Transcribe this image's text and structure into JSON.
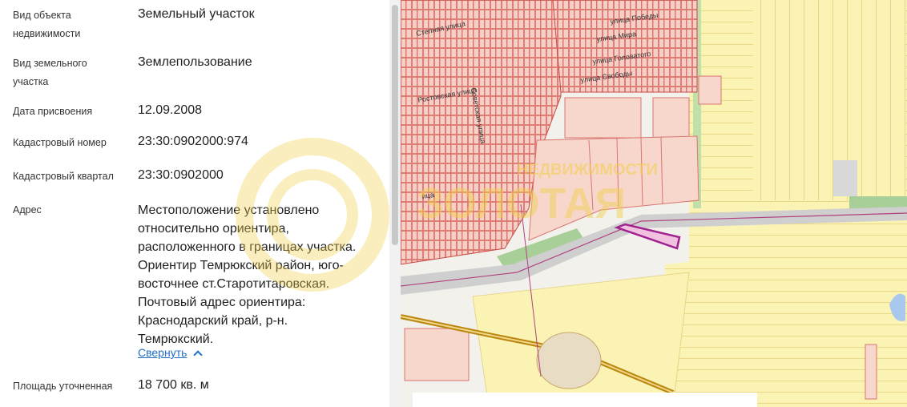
{
  "details": {
    "rows": [
      {
        "label": "Вид объекта\nнедвижимости",
        "value": "Земельный участок"
      },
      {
        "label": "Вид земельного\nучастка",
        "value": "Землепользование"
      },
      {
        "label": "Дата присвоения",
        "value": "12.09.2008"
      },
      {
        "label": "Кадастровый номер",
        "value": "23:30:0902000:974"
      },
      {
        "label": "Кадастровый квартал",
        "value": "23:30:0902000"
      },
      {
        "label": "Адрес",
        "value": "Местоположение установлено\nотносительно ориентира,\nрасположенного в границах участка.\nОриентир Темрюкский район, юго-\nвосточнее ст.Старотитаровская.\nПочтовый адрес ориентира:\nКраснодарский край, р-н.\nТемрюкский."
      },
      {
        "label": "Площадь уточненная",
        "value": "18 700 кв. м"
      }
    ],
    "collapse_label": "Свернуть"
  },
  "map": {
    "streets": [
      "Степная улица",
      "Ростовская улица",
      "улица Победы",
      "улица Мира",
      "улица Головатого",
      "улица Свободы",
      "ица",
      "Советская улица"
    ]
  },
  "watermark": {
    "line1": "НЕДВИЖИМОСТИ",
    "line2": "ЗОЛОТАЯ"
  },
  "colors": {
    "field_yellow": "#fbf3b4",
    "plot_pink": "#f7d6cc",
    "highlight": "#a0218f",
    "link": "#1f6fc7"
  }
}
